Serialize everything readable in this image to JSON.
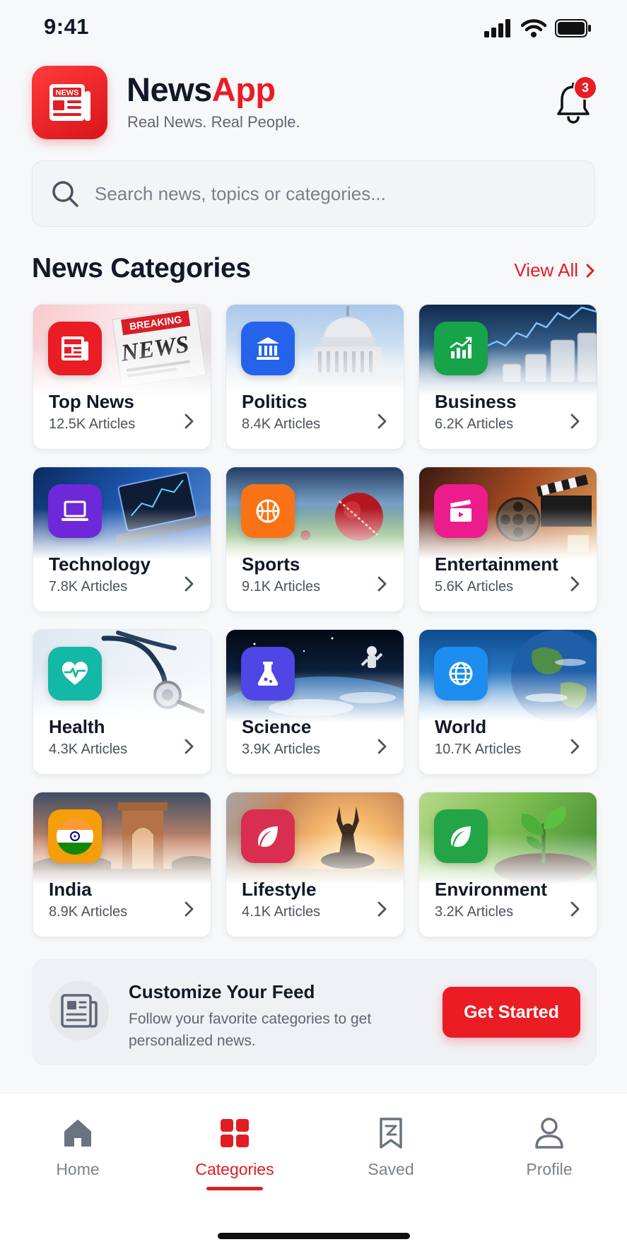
{
  "status_bar": {
    "time": "9:41"
  },
  "header": {
    "app_name_part1": "News",
    "app_name_part2": "App",
    "tagline": "Real News. Real People.",
    "logo_label": "NEWS",
    "notification_count": "3"
  },
  "search": {
    "placeholder": "Search news, topics or categories..."
  },
  "section": {
    "title": "News Categories",
    "view_all": "View All"
  },
  "categories": [
    {
      "title": "Top News",
      "count": "12.5K Articles",
      "icon": "newspaper-icon",
      "color": "#ea1c24"
    },
    {
      "title": "Politics",
      "count": "8.4K Articles",
      "icon": "government-building-icon",
      "color": "#2563eb"
    },
    {
      "title": "Business",
      "count": "6.2K Articles",
      "icon": "bar-chart-icon",
      "color": "#16a34a"
    },
    {
      "title": "Technology",
      "count": "7.8K Articles",
      "icon": "laptop-icon",
      "color": "#6d28d9"
    },
    {
      "title": "Sports",
      "count": "9.1K Articles",
      "icon": "basketball-icon",
      "color": "#f97316"
    },
    {
      "title": "Entertainment",
      "count": "5.6K Articles",
      "icon": "clapperboard-icon",
      "color": "#ec1c8c"
    },
    {
      "title": "Health",
      "count": "4.3K Articles",
      "icon": "heart-pulse-icon",
      "color": "#14b8a6"
    },
    {
      "title": "Science",
      "count": "3.9K Articles",
      "icon": "flask-icon",
      "color": "#4f46e5"
    },
    {
      "title": "World",
      "count": "10.7K Articles",
      "icon": "globe-icon",
      "color": "#1d8ef0"
    },
    {
      "title": "India",
      "count": "8.9K Articles",
      "icon": "india-flag-icon",
      "color": "#f59e0b"
    },
    {
      "title": "Lifestyle",
      "count": "4.1K Articles",
      "icon": "leaf-icon",
      "color": "#d92e4f"
    },
    {
      "title": "Environment",
      "count": "3.2K Articles",
      "icon": "leaf-icon",
      "color": "#22a447"
    }
  ],
  "artwork": {
    "top_news_banner": "BREAKING",
    "top_news_headline": "NEWS"
  },
  "promo": {
    "title": "Customize Your Feed",
    "text": "Follow your favorite categories to get personalized news.",
    "button": "Get Started"
  },
  "bottom_nav": [
    {
      "label": "Home",
      "icon": "home-icon",
      "active": false
    },
    {
      "label": "Categories",
      "icon": "categories-grid-icon",
      "active": true
    },
    {
      "label": "Saved",
      "icon": "bookmark-icon",
      "active": false
    },
    {
      "label": "Profile",
      "icon": "profile-icon",
      "active": false
    }
  ],
  "colors": {
    "accent": "#ea1c24",
    "text": "#111827",
    "muted": "#5f6675"
  }
}
